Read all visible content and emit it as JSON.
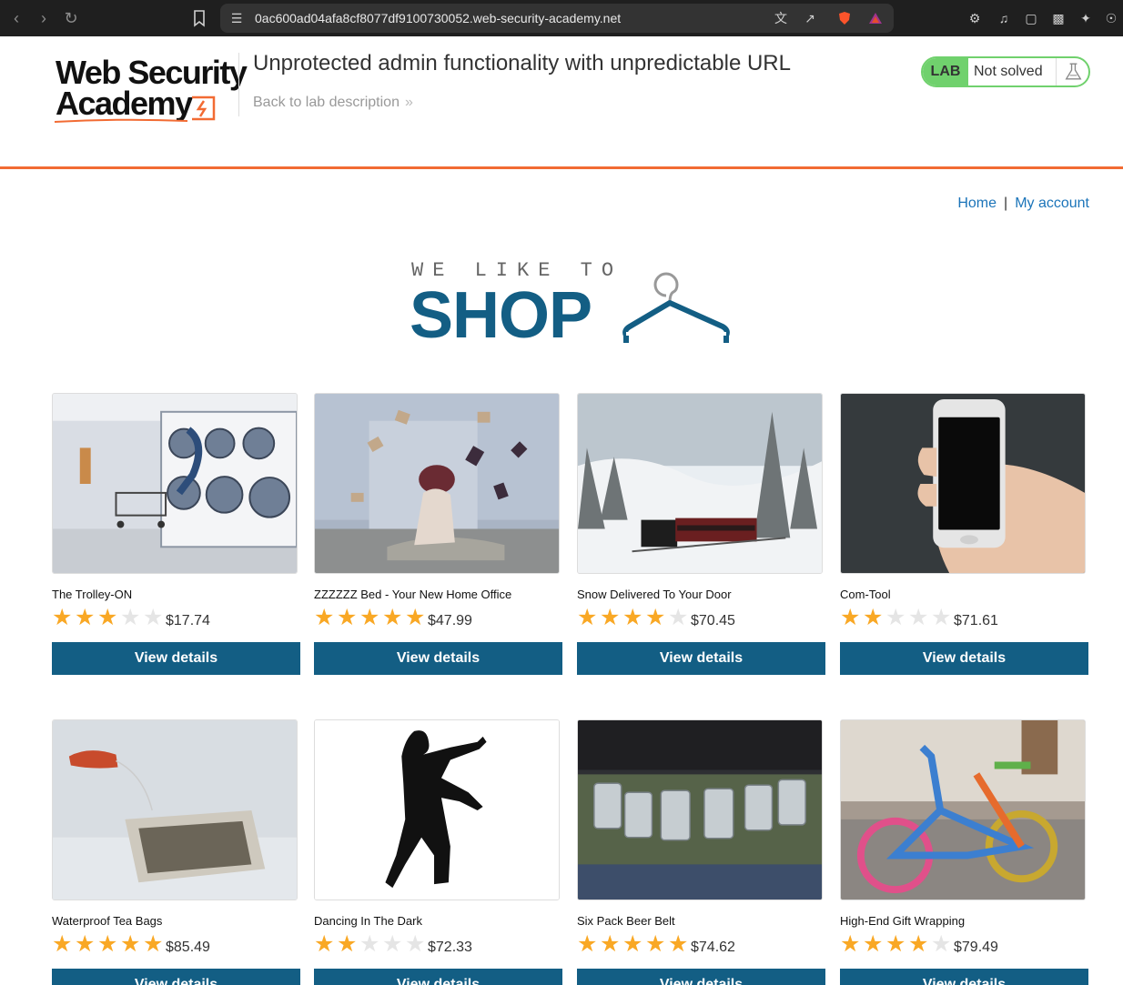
{
  "browser": {
    "url": "0ac600ad04afa8cf8077df9100730052.web-security-academy.net"
  },
  "header": {
    "logo_line1": "Web Security",
    "logo_line2": "Academy",
    "lab_title": "Unprotected admin functionality with unpredictable URL",
    "back_link": "Back to lab description",
    "lab_badge": "LAB",
    "lab_status": "Not solved",
    "status_color": "#70d16d",
    "accent_color": "#f26b33"
  },
  "nav": {
    "home": "Home",
    "separator": "|",
    "my_account": "My account"
  },
  "banner": {
    "small": "WE LIKE TO",
    "big": "SHOP",
    "brand_color": "#135e84"
  },
  "products": [
    {
      "name": "The Trolley-ON",
      "price": "$17.74",
      "rating": 3,
      "button": "View details",
      "image": "laundromat"
    },
    {
      "name": "ZZZZZZ Bed - Your New Home Office",
      "price": "$47.99",
      "rating": 5,
      "button": "View details",
      "image": "bed-flying-books"
    },
    {
      "name": "Snow Delivered To Your Door",
      "price": "$70.45",
      "rating": 4,
      "button": "View details",
      "image": "snow-train"
    },
    {
      "name": "Com-Tool",
      "price": "$71.61",
      "rating": 2,
      "button": "View details",
      "image": "phone-in-hand"
    },
    {
      "name": "Waterproof Tea Bags",
      "price": "$85.49",
      "rating": 5,
      "button": "View details",
      "image": "tea-bag"
    },
    {
      "name": "Dancing In The Dark",
      "price": "$72.33",
      "rating": 2,
      "button": "View details",
      "image": "dancing-silhouette"
    },
    {
      "name": "Six Pack Beer Belt",
      "price": "$74.62",
      "rating": 5,
      "button": "View details",
      "image": "beer-belt"
    },
    {
      "name": "High-End Gift Wrapping",
      "price": "$79.49",
      "rating": 4,
      "button": "View details",
      "image": "knitted-bicycle"
    }
  ]
}
